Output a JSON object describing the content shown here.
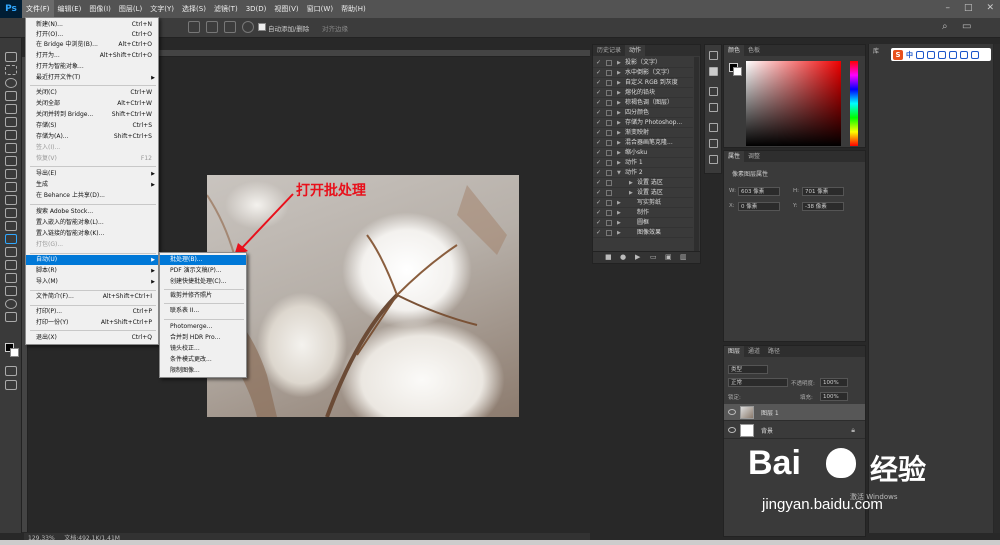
{
  "app": {
    "logo": "Ps",
    "menus": [
      "文件(F)",
      "编辑(E)",
      "图像(I)",
      "图层(L)",
      "文字(Y)",
      "选择(S)",
      "滤镜(T)",
      "3D(D)",
      "视图(V)",
      "窗口(W)",
      "帮助(H)"
    ]
  },
  "options": {
    "auto_add_label": "自动添加/删除",
    "align_label": "对齐边缘"
  },
  "file_menu": {
    "items": [
      {
        "label": "新建(N)...",
        "shortcut": "Ctrl+N"
      },
      {
        "label": "打开(O)...",
        "shortcut": "Ctrl+O"
      },
      {
        "label": "在 Bridge 中浏览(B)...",
        "shortcut": "Alt+Ctrl+O"
      },
      {
        "label": "打开为...",
        "shortcut": "Alt+Shift+Ctrl+O"
      },
      {
        "label": "打开为智能对象...",
        "shortcut": ""
      },
      {
        "label": "最近打开文件(T)",
        "shortcut": ""
      },
      {
        "label": "关闭(C)",
        "shortcut": "Ctrl+W"
      },
      {
        "label": "关闭全部",
        "shortcut": "Alt+Ctrl+W"
      },
      {
        "label": "关闭并转到 Bridge...",
        "shortcut": "Shift+Ctrl+W"
      },
      {
        "label": "存储(S)",
        "shortcut": "Ctrl+S"
      },
      {
        "label": "存储为(A)...",
        "shortcut": "Shift+Ctrl+S"
      },
      {
        "label": "签入(I)...",
        "shortcut": ""
      },
      {
        "label": "恢复(V)",
        "shortcut": "F12"
      },
      {
        "label": "导出(E)",
        "shortcut": ""
      },
      {
        "label": "生成",
        "shortcut": ""
      },
      {
        "label": "在 Behance 上共享(D)...",
        "shortcut": ""
      },
      {
        "label": "搜索 Adobe Stock...",
        "shortcut": ""
      },
      {
        "label": "置入嵌入的智能对象(L)...",
        "shortcut": ""
      },
      {
        "label": "置入链接的智能对象(K)...",
        "shortcut": ""
      },
      {
        "label": "打包(G)...",
        "shortcut": ""
      },
      {
        "label": "自动(U)",
        "shortcut": ""
      },
      {
        "label": "脚本(R)",
        "shortcut": ""
      },
      {
        "label": "导入(M)",
        "shortcut": ""
      },
      {
        "label": "文件简介(F)...",
        "shortcut": "Alt+Shift+Ctrl+I"
      },
      {
        "label": "打印(P)...",
        "shortcut": "Ctrl+P"
      },
      {
        "label": "打印一份(Y)",
        "shortcut": "Alt+Shift+Ctrl+P"
      },
      {
        "label": "退出(X)",
        "shortcut": "Ctrl+Q"
      }
    ]
  },
  "auto_submenu": {
    "items": [
      "批处理(B)...",
      "PDF 演示文稿(P)...",
      "创建快捷批处理(C)...",
      "裁剪并修齐照片",
      "联系表 II...",
      "Photomerge...",
      "合并到 HDR Pro...",
      "镜头校正...",
      "条件模式更改...",
      "限制图像..."
    ]
  },
  "annotation": "打开批处理",
  "status": {
    "zoom": "129.33%",
    "doc": "文档:492.1K/1.41M"
  },
  "actions_panel": {
    "tabs": [
      "历史记录",
      "动作"
    ],
    "rows": [
      "投影（文字）",
      "水中倒影（文字）",
      "自定义 RGB 到灰度",
      "熔化的铅块",
      "棕褐色调（图层）",
      "四分颜色",
      "存储为 Photoshop...",
      "渐变映射",
      "混合器画笔克隆...",
      "缩小sku",
      "动作 1",
      "动作 2",
      "设置 选区",
      "设置 选区",
      "写实剪纸",
      "制作",
      "圆框",
      "图像效果"
    ]
  },
  "color_panel": {
    "tabs": [
      "颜色",
      "色板"
    ]
  },
  "properties_panel": {
    "tabs": [
      "属性",
      "调整"
    ],
    "title": "像素图层属性",
    "w_label": "W:",
    "w_value": "603 像素",
    "h_label": "H:",
    "h_value": "701 像素",
    "x_label": "X:",
    "x_value": "0 像素",
    "y_label": "Y:",
    "y_value": "-38 像素"
  },
  "layers_panel": {
    "tabs": [
      "图层",
      "通道",
      "路径"
    ],
    "kind_label": "类型",
    "blend_mode": "正常",
    "opacity_label": "不透明度:",
    "opacity_value": "100%",
    "lock_label": "锁定:",
    "fill_label": "填充:",
    "fill_value": "100%",
    "layers": [
      "图层 1",
      "背景"
    ]
  },
  "library": {
    "tab": "库",
    "ime_char": "中"
  },
  "watermark": {
    "bai": "Bai",
    "du": "du",
    "jingyan": "经验",
    "url": "jingyan.baidu.com",
    "windows": "激活 Windows"
  },
  "colors": {
    "menu_highlight": "#0078d7",
    "annotation": "#e8101b",
    "ps_blue": "#31a8ff"
  }
}
